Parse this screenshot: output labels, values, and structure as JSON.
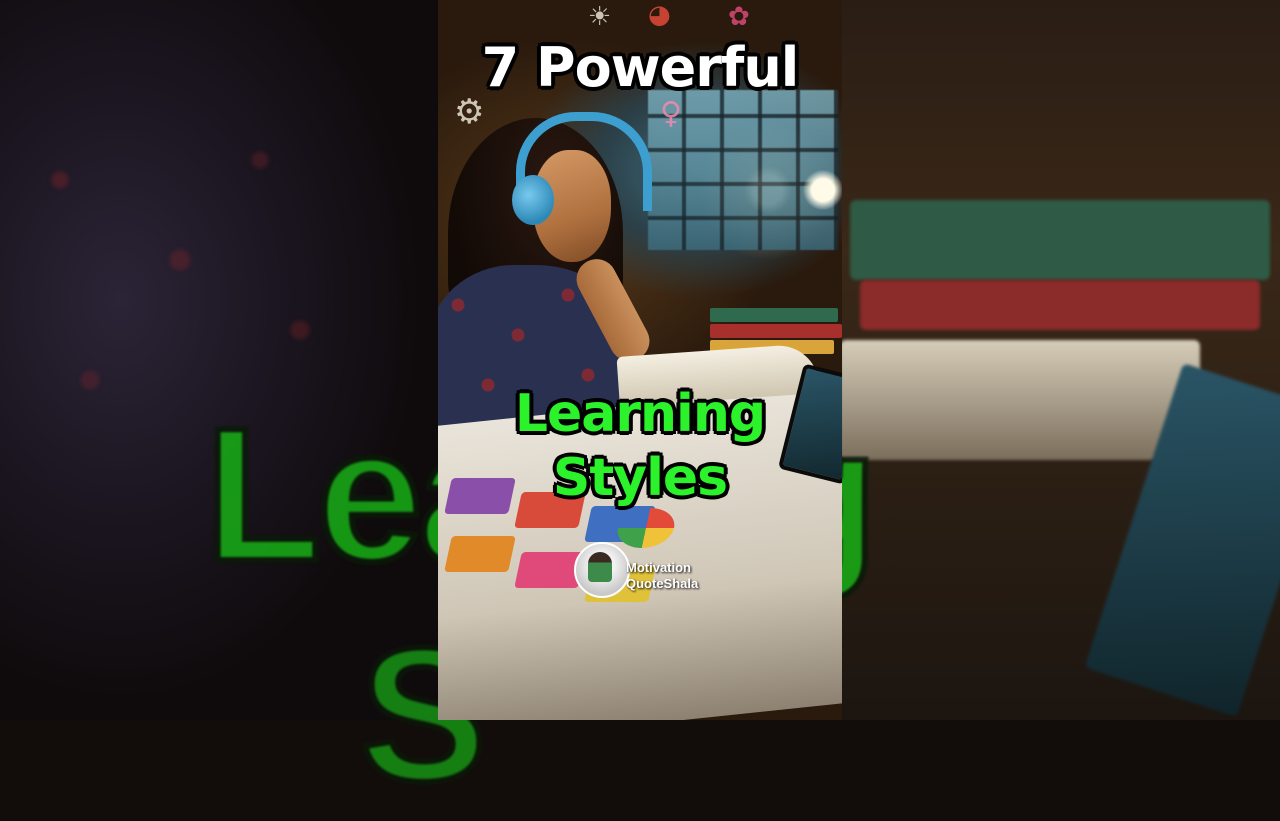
{
  "title": {
    "line_top": "7 Powerful",
    "line_green_1": "Learning",
    "line_green_2": "Styles"
  },
  "background_text": {
    "left": "Lea",
    "right": "ng",
    "bottom": "S"
  },
  "watermark": {
    "line1": "Motivation",
    "line2": "QuoteShala"
  },
  "colors": {
    "title_white": "#ffffff",
    "title_green": "#2bf22a",
    "headphones": "#3d9fcf"
  }
}
